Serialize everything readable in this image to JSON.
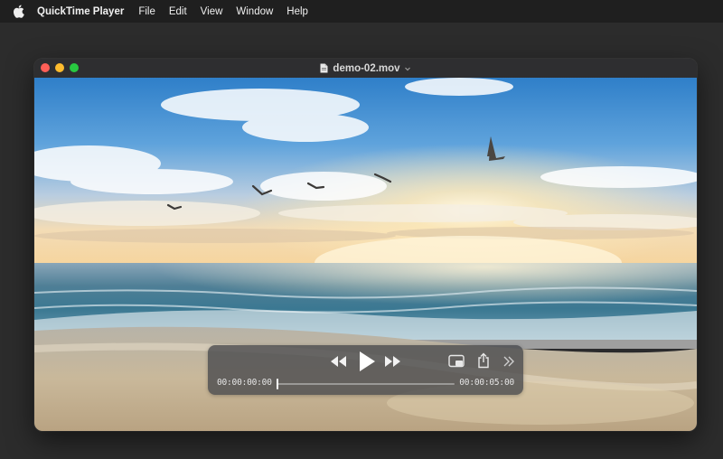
{
  "menubar": {
    "apple_icon": "apple-logo-icon",
    "app_name": "QuickTime Player",
    "items": [
      "File",
      "Edit",
      "View",
      "Window",
      "Help"
    ]
  },
  "window": {
    "title": "demo-02.mov",
    "title_icon": "document-icon",
    "title_menu_icon": "chevron-down-icon",
    "traffic_lights": {
      "close": "#ff5f57",
      "minimize": "#febc2e",
      "zoom": "#28c840"
    }
  },
  "video": {
    "scene": "beach-sunset-with-seagulls"
  },
  "controls": {
    "rewind_icon": "rewind-icon",
    "play_icon": "play-icon",
    "fast_forward_icon": "fast-forward-icon",
    "pip_icon": "picture-in-picture-icon",
    "share_icon": "share-icon",
    "more_icon": "chevron-double-right-icon",
    "current_time": "00:00:00:00",
    "total_time": "00:00:05:00",
    "progress": 0.0
  }
}
